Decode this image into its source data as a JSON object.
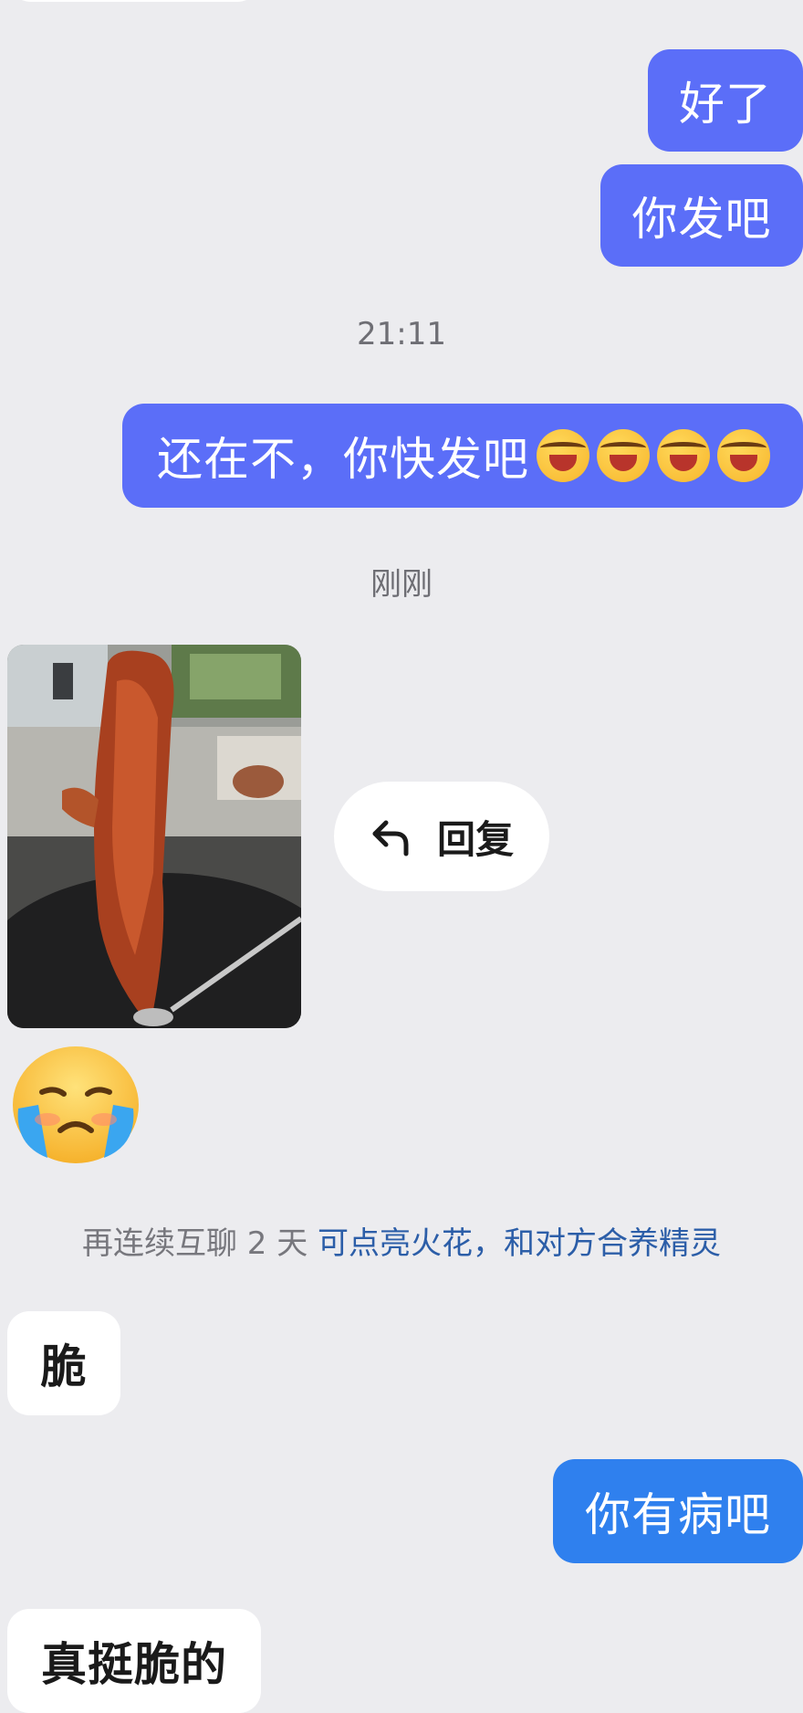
{
  "messages": {
    "m1": "好了",
    "m2": "你发吧",
    "ts1": "21:11",
    "m3": "还在不，你快发吧",
    "m3_emoji": "rofl-emoji x4",
    "ts2": "刚刚",
    "reply_label": "回复",
    "cry_emoji": "loudly-crying-face",
    "system_prefix": "再连续互聊 2 天 ",
    "system_link": "可点亮火花，和对方合养精灵",
    "m4": "脆",
    "m5": "你有病吧",
    "m6": "真挺脆的"
  },
  "colors": {
    "outgoing_bubble": "#5b6ef8",
    "outgoing_bubble_alt": "#2f80ee",
    "incoming_bubble": "#ffffff",
    "background": "#ececef",
    "link": "#2c5ea8"
  }
}
